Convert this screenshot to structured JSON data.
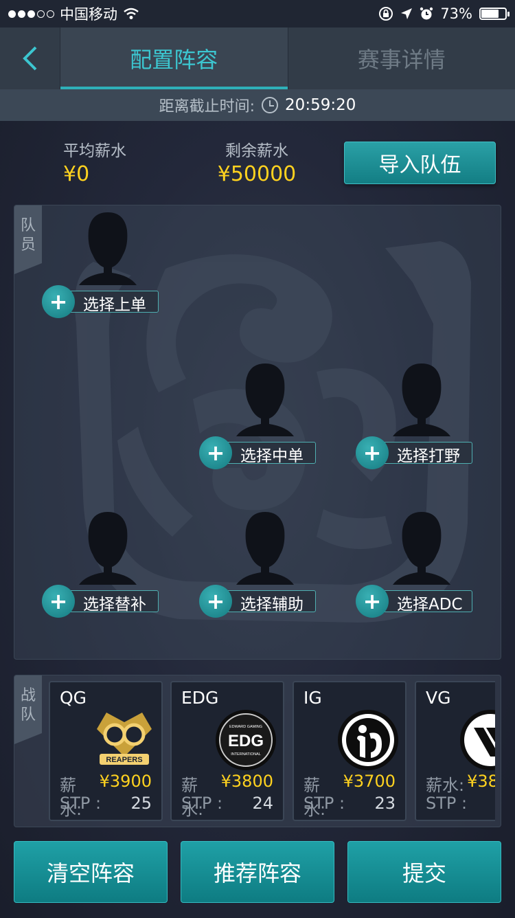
{
  "status_bar": {
    "carrier": "中国移动",
    "battery": "73%",
    "battery_level": 0.73
  },
  "nav": {
    "tabs": [
      {
        "label": "配置阵容",
        "active": true
      },
      {
        "label": "赛事详情",
        "active": false
      }
    ]
  },
  "deadline": {
    "label": "距离截止时间:",
    "time": "20:59:20"
  },
  "salary": {
    "avg_label": "平均薪水",
    "avg_value": "¥0",
    "remaining_label": "剩余薪水",
    "remaining_value": "¥50000"
  },
  "import_button": "导入队伍",
  "roster": {
    "tag": "队员",
    "slots": [
      {
        "label": "选择上单"
      },
      {
        "label": "选择中单"
      },
      {
        "label": "选择打野"
      },
      {
        "label": "选择替补"
      },
      {
        "label": "选择辅助"
      },
      {
        "label": "选择ADC"
      }
    ]
  },
  "teams": {
    "tag": "战队",
    "salary_label": "薪水:",
    "stp_label": "STP :",
    "items": [
      {
        "name": "QG",
        "salary": "¥3900",
        "stp": "25",
        "logo_text": "REAPERS"
      },
      {
        "name": "EDG",
        "salary": "¥3800",
        "stp": "24",
        "logo_text": "EDG",
        "logo_top": "EDWARD GAMING",
        "logo_bottom": "INTERNATIONAL"
      },
      {
        "name": "IG",
        "salary": "¥3700",
        "stp": "23"
      },
      {
        "name": "VG",
        "salary": "¥38",
        "stp": ""
      }
    ]
  },
  "bottom_buttons": {
    "clear": "清空阵容",
    "recommend": "推荐阵容",
    "submit": "提交"
  },
  "colors": {
    "accent": "#3cc6d0",
    "money": "#ffd21f",
    "button": "#1fa0a6"
  }
}
